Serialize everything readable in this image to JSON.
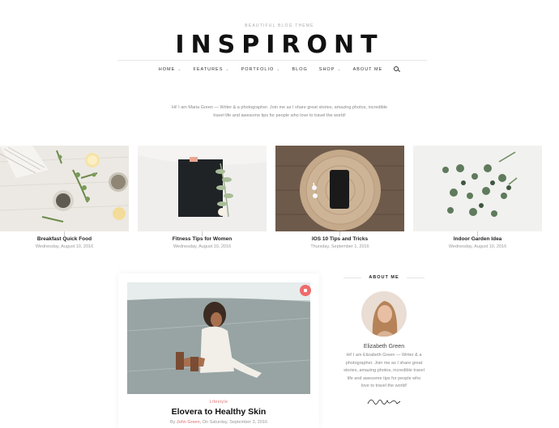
{
  "site": {
    "tagline": "BEAUTIFUL BLOG THEME",
    "logo": "INSPIRONT"
  },
  "nav": {
    "items": [
      {
        "label": "HOME",
        "dropdown": true
      },
      {
        "label": "FEATURES",
        "dropdown": true
      },
      {
        "label": "PORTFOLIO",
        "dropdown": true
      },
      {
        "label": "BLOG",
        "dropdown": false
      },
      {
        "label": "SHOP",
        "dropdown": true
      },
      {
        "label": "ABOUT ME",
        "dropdown": false
      }
    ],
    "search_icon": "search-icon"
  },
  "intro": {
    "line1": "Hi! I am Maria Green — Writer & a photographer. Join me as I share great stories, amazing photos, incredible",
    "line2": "travel life and awesome tips for people who love to travel the world!"
  },
  "slider": [
    {
      "title": "Breakfast Quick Food",
      "date": "Wednesday, August 10, 2016"
    },
    {
      "title": "Fitness Tips for Women",
      "date": "Wednesday, August 10, 2016"
    },
    {
      "title": "IOS 10 Tips and Tricks",
      "date": "Thursday, September 1, 2016"
    },
    {
      "title": "Indoor Garden Idea",
      "date": "Wednesday, August 10, 2016"
    }
  ],
  "post": {
    "category": "Lifestyle",
    "title": "Elovera to Healthy Skin",
    "meta_prefix": "By",
    "author": "John Green",
    "meta_suffix": ", On Saturday, September 3, 2016",
    "badge_color": "#ef6b6b"
  },
  "sidebar": {
    "heading": "ABOUT ME",
    "name": "Elizabeth Green",
    "bio": "Hi! I am Elizabeth Green — Writer & a photographer. Join me as I share great stories, amazing photos, incredible travel life and awesome tips for people who love to travel the world!",
    "signature": "Elizabeth Green"
  },
  "colors": {
    "accent": "#e06b6b",
    "text": "#222222",
    "muted": "#999999"
  }
}
